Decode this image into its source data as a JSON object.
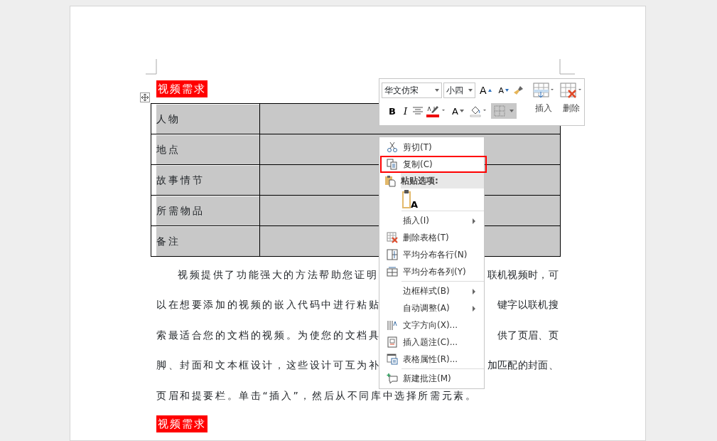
{
  "document": {
    "heading": "视频需求",
    "table": {
      "rows": [
        {
          "label": "人物"
        },
        {
          "label": "地点"
        },
        {
          "label": "故事情节"
        },
        {
          "label": "所需物品"
        },
        {
          "label": "备注"
        }
      ]
    },
    "paragraph_lines": [
      {
        "left": "视频提供了功能强大的方法帮助您证明",
        "right": "联机视频时，可",
        "indent": true
      },
      {
        "left": "以在想要添加的视频的嵌入代码中进行粘贴",
        "right": "键字以联机搜",
        "indent": false
      },
      {
        "left": "索最适合您的文档的视频。为使您的文档具",
        "right": "供了页眉、页",
        "indent": false
      },
      {
        "left": "脚、封面和文本框设计，这些设计可互为补",
        "right": "加匹配的封面、",
        "indent": false
      },
      {
        "left": "页眉和提要栏。单击“插入”，然后从不同库中选择所需元素。",
        "indent": false
      }
    ],
    "heading_2": "视频需求"
  },
  "mini_toolbar": {
    "font": "华文仿宋",
    "size": "小四",
    "grow_font": "A",
    "shrink_font": "A",
    "bold": "B",
    "italic": "I",
    "font_color": "A",
    "borders_active": true,
    "insert": "插入",
    "delete": "删除"
  },
  "context_menu": [
    {
      "kind": "item",
      "label": "剪切(T)",
      "submenu": false,
      "selected": false
    },
    {
      "kind": "item",
      "label": "复制(C)",
      "submenu": false,
      "selected": true
    },
    {
      "kind": "header",
      "label": "粘贴选项:"
    },
    {
      "kind": "paste_option",
      "label": "A"
    },
    {
      "kind": "separator"
    },
    {
      "kind": "item",
      "label": "插入(I)",
      "submenu": true,
      "selected": false
    },
    {
      "kind": "item",
      "label": "删除表格(T)",
      "submenu": false,
      "selected": false
    },
    {
      "kind": "item",
      "label": "平均分布各行(N)",
      "submenu": false,
      "selected": false
    },
    {
      "kind": "item",
      "label": "平均分布各列(Y)",
      "submenu": false,
      "selected": false
    },
    {
      "kind": "separator"
    },
    {
      "kind": "item",
      "label": "边框样式(B)",
      "submenu": true,
      "selected": false
    },
    {
      "kind": "item",
      "label": "自动调整(A)",
      "submenu": true,
      "selected": false
    },
    {
      "kind": "item",
      "label": "文字方向(X)...",
      "submenu": false,
      "selected": false
    },
    {
      "kind": "item",
      "label": "插入题注(C)...",
      "submenu": false,
      "selected": false
    },
    {
      "kind": "item",
      "label": "表格属性(R)...",
      "submenu": false,
      "selected": false
    },
    {
      "kind": "separator"
    },
    {
      "kind": "item",
      "label": "新建批注(M)",
      "submenu": false,
      "selected": false
    }
  ]
}
